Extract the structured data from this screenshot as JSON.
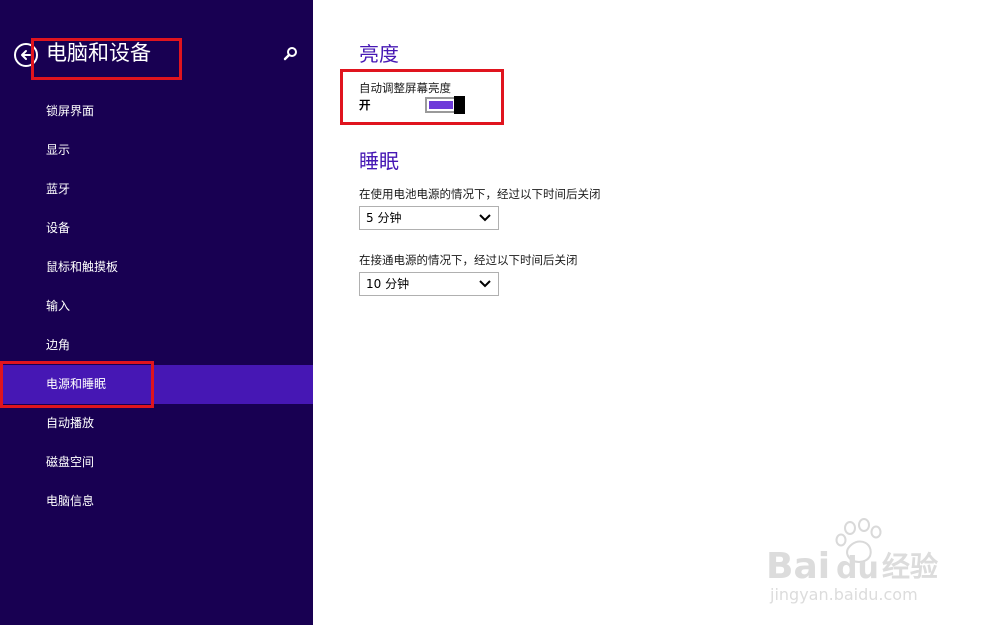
{
  "sidebar": {
    "title": "电脑和设备",
    "items": [
      {
        "label": "锁屏界面"
      },
      {
        "label": "显示"
      },
      {
        "label": "蓝牙"
      },
      {
        "label": "设备"
      },
      {
        "label": "鼠标和触摸板"
      },
      {
        "label": "输入"
      },
      {
        "label": "边角"
      },
      {
        "label": "电源和睡眠",
        "selected": true
      },
      {
        "label": "自动播放"
      },
      {
        "label": "磁盘空间"
      },
      {
        "label": "电脑信息"
      }
    ]
  },
  "icons": {
    "back": "back-arrow-icon",
    "search": "search-icon",
    "dropdown": "chevron-down-icon"
  },
  "brightness": {
    "heading": "亮度",
    "auto_label": "自动调整屏幕亮度",
    "toggle_state": "开",
    "toggle_on": true
  },
  "sleep": {
    "heading": "睡眠",
    "battery_label": "在使用电池电源的情况下，经过以下时间后关闭",
    "battery_value": "5 分钟",
    "plugged_label": "在接通电源的情况下，经过以下时间后关闭",
    "plugged_value": "10 分钟"
  },
  "watermark": {
    "brand_latin": "Bai",
    "brand_du": "du",
    "brand_cn": "经验",
    "url": "jingyan.baidu.com"
  },
  "colors": {
    "sidebar_bg": "#180052",
    "accent": "#4617b4",
    "toggle_fill": "#6e3bd9",
    "annotation": "#e0141e"
  }
}
